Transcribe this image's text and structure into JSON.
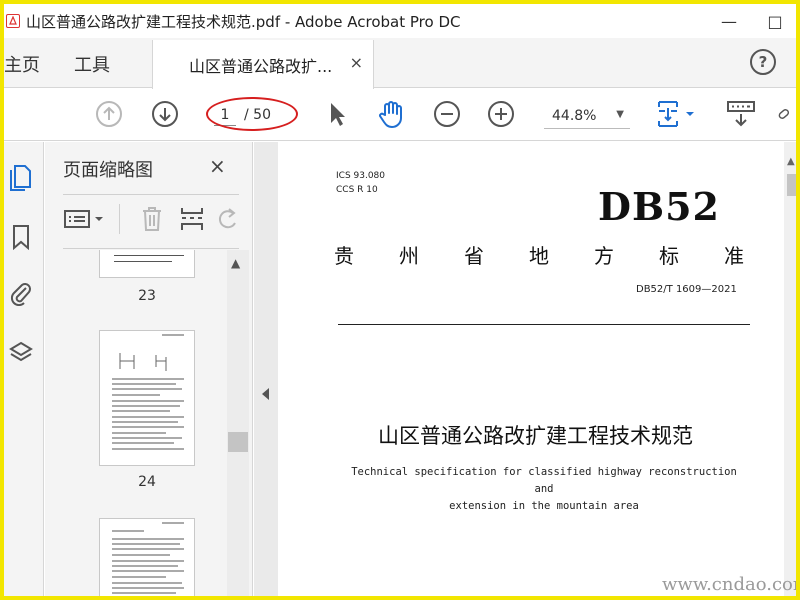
{
  "window": {
    "title": "山区普通公路改扩建工程技术规范.pdf - Adobe Acrobat Pro DC",
    "minimize_glyph": "—",
    "maximize_glyph": "□"
  },
  "tabs": {
    "home": "主页",
    "tools": "工具",
    "document": "山区普通公路改扩...",
    "close_glyph": "×",
    "help_glyph": "?"
  },
  "toolbar": {
    "current_page": "1",
    "total_pages": "/ 50",
    "zoom": "44.8%",
    "zoom_caret": "▼"
  },
  "panel": {
    "title": "页面缩略图",
    "close_glyph": "×",
    "scroll_up": "▲",
    "thumbnails": [
      {
        "page": "23"
      },
      {
        "page": "24"
      }
    ]
  },
  "document": {
    "ics": "ICS  93.080",
    "ccs": "CCS  R 10",
    "logo": "DB52",
    "category": [
      "贵",
      "州",
      "省",
      "地",
      "方",
      "标",
      "准"
    ],
    "code": "DB52/T 1609—2021",
    "title_cn": "山区普通公路改扩建工程技术规范",
    "title_en_line1": "Technical specification for classified highway reconstruction and",
    "title_en_line2": "extension in the mountain area",
    "scroll_up": "▲"
  },
  "watermark": "www.cndao.com",
  "colors": {
    "frame_border": "#f2e600",
    "accent_blue": "#1f6fd1",
    "annotation_red": "#d61f1f",
    "icon_gray": "#555555",
    "icon_disabled": "#b8b8b8"
  },
  "icons": {
    "prev_page": "arrow-up-circle-icon",
    "next_page": "arrow-down-circle-icon",
    "select": "cursor-arrow-icon",
    "hand": "hand-icon",
    "zoom_out": "zoom-out-icon",
    "zoom_in": "zoom-in-icon",
    "fit": "fit-page-icon",
    "keyboard": "keyboard-icon",
    "link": "link-icon"
  }
}
